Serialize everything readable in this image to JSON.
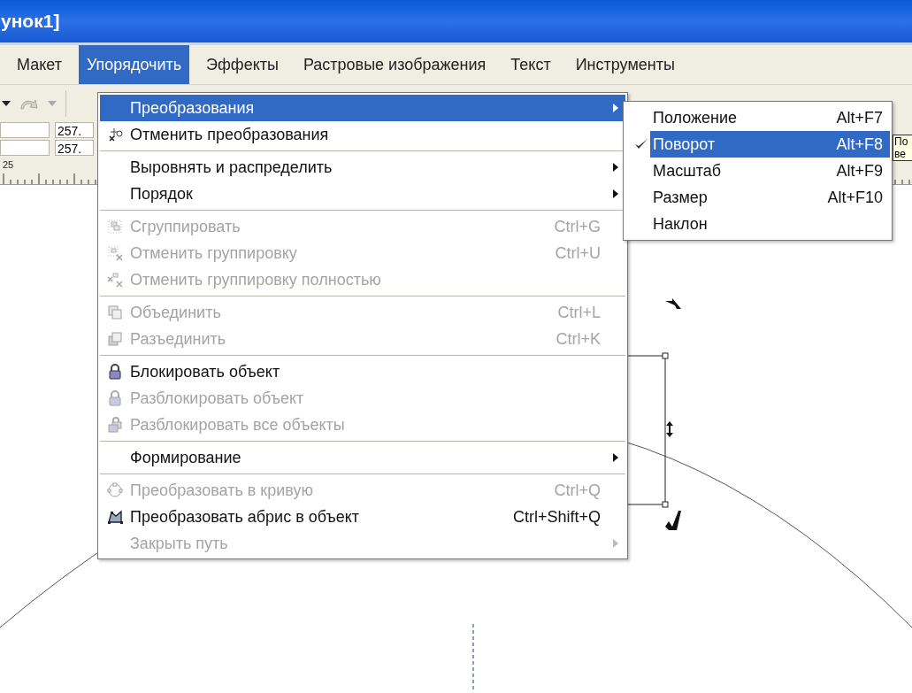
{
  "window": {
    "title": "унок1]"
  },
  "menubar": [
    {
      "label": "Макет",
      "selected": false
    },
    {
      "label": "Упорядочить",
      "selected": true
    },
    {
      "label": "Эффекты",
      "selected": false
    },
    {
      "label": "Растровые изображения",
      "selected": false
    },
    {
      "label": "Текст",
      "selected": false
    },
    {
      "label": "Инструменты",
      "selected": false
    }
  ],
  "toolbar": {
    "fields": [
      "257.",
      "257."
    ]
  },
  "ruler": {
    "label": "25"
  },
  "menu": {
    "items": [
      {
        "kind": "item",
        "label": "Преобразования",
        "submenu": true,
        "disabled": false,
        "selected": true
      },
      {
        "kind": "item",
        "label": "Отменить преобразования",
        "submenu": false,
        "disabled": false,
        "selected": false
      },
      {
        "kind": "separator"
      },
      {
        "kind": "item",
        "label": "Выровнять и распределить",
        "submenu": true,
        "disabled": false,
        "selected": false
      },
      {
        "kind": "item",
        "label": "Порядок",
        "submenu": true,
        "disabled": false,
        "selected": false
      },
      {
        "kind": "separator"
      },
      {
        "kind": "item",
        "label": "Сгруппировать",
        "shortcut": "Ctrl+G",
        "submenu": false,
        "disabled": true,
        "selected": false
      },
      {
        "kind": "item",
        "label": "Отменить группировку",
        "shortcut": "Ctrl+U",
        "submenu": false,
        "disabled": true,
        "selected": false
      },
      {
        "kind": "item",
        "label": "Отменить группировку полностью",
        "submenu": false,
        "disabled": true,
        "selected": false
      },
      {
        "kind": "separator"
      },
      {
        "kind": "item",
        "label": "Объединить",
        "shortcut": "Ctrl+L",
        "submenu": false,
        "disabled": true,
        "selected": false
      },
      {
        "kind": "item",
        "label": "Разъединить",
        "shortcut": "Ctrl+K",
        "submenu": false,
        "disabled": true,
        "selected": false
      },
      {
        "kind": "separator"
      },
      {
        "kind": "item",
        "label": "Блокировать объект",
        "submenu": false,
        "disabled": false,
        "selected": false
      },
      {
        "kind": "item",
        "label": "Разблокировать объект",
        "submenu": false,
        "disabled": true,
        "selected": false
      },
      {
        "kind": "item",
        "label": "Разблокировать все объекты",
        "submenu": false,
        "disabled": true,
        "selected": false
      },
      {
        "kind": "separator"
      },
      {
        "kind": "item",
        "label": "Формирование",
        "submenu": true,
        "disabled": false,
        "selected": false
      },
      {
        "kind": "separator"
      },
      {
        "kind": "item",
        "label": "Преобразовать в кривую",
        "shortcut": "Ctrl+Q",
        "submenu": false,
        "disabled": true,
        "selected": false
      },
      {
        "kind": "item",
        "label": "Преобразовать абрис в объект",
        "shortcut": "Ctrl+Shift+Q",
        "submenu": false,
        "disabled": false,
        "selected": false
      },
      {
        "kind": "item",
        "label": "Закрыть путь",
        "submenu": true,
        "disabled": true,
        "selected": false
      }
    ]
  },
  "submenu": {
    "items": [
      {
        "label": "Положение",
        "shortcut": "Alt+F7",
        "checked": false,
        "selected": false
      },
      {
        "label": "Поворот",
        "shortcut": "Alt+F8",
        "checked": true,
        "selected": true
      },
      {
        "label": "Масштаб",
        "shortcut": "Alt+F9",
        "checked": false,
        "selected": false
      },
      {
        "label": "Размер",
        "shortcut": "Alt+F10",
        "checked": false,
        "selected": false
      },
      {
        "label": "Наклон",
        "checked": false,
        "selected": false
      }
    ]
  },
  "tooltip": {
    "lines": [
      "По",
      "ве"
    ]
  }
}
